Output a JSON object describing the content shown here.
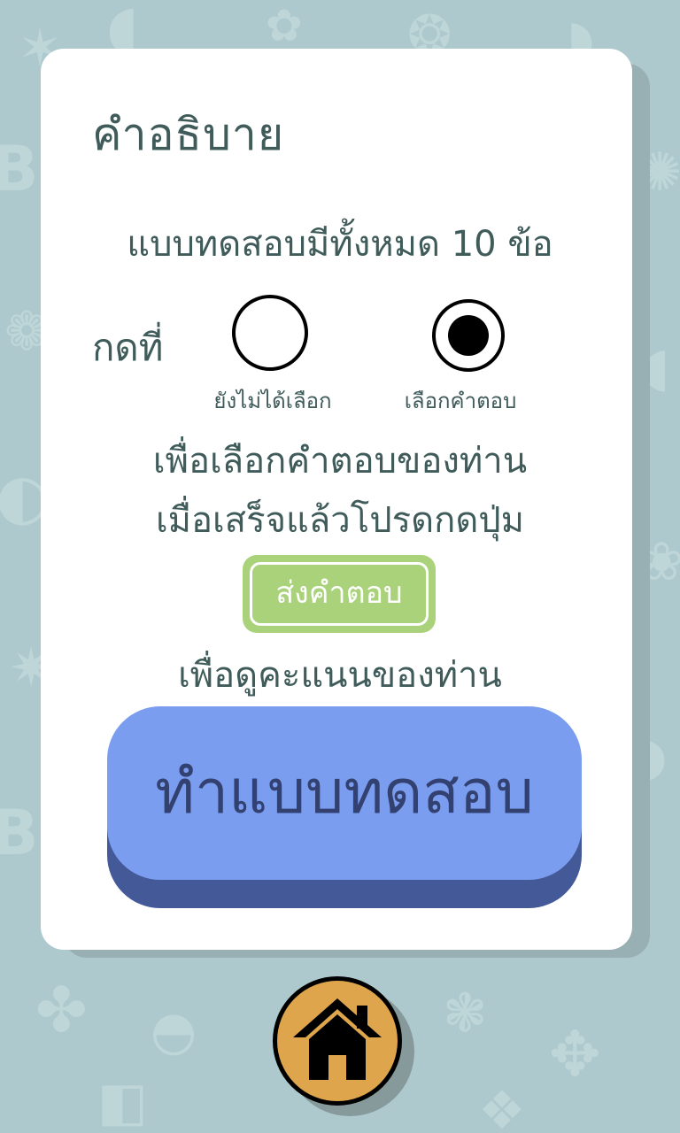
{
  "background": {
    "color": "#adc9cd",
    "pattern_color": "#c2d8db"
  },
  "instructions": {
    "title": "คำอธิบาย",
    "question_count_text": "แบบทดสอบมีทั้งหมด 10 ข้อ",
    "press_label": "กดที่",
    "radio_unselected_caption": "ยังไม่ได้เลือก",
    "radio_selected_caption": "เลือกคำตอบ",
    "line1": "เพื่อเลือกคำตอบของท่าน",
    "line2": "เมื่อเสร็จแล้วโปรดกดปุ่ม",
    "submit_badge_label": "ส่งคำตอบ",
    "line3": "เพื่อดูคะแนนของท่าน",
    "text_color": "#3f5b5a"
  },
  "start_button": {
    "label": "ทำแบบทดสอบ",
    "color": "#7b9def",
    "base_color": "#435998",
    "text_color": "#324170"
  },
  "home_button": {
    "icon": "home-icon",
    "color": "#dfa54c"
  }
}
